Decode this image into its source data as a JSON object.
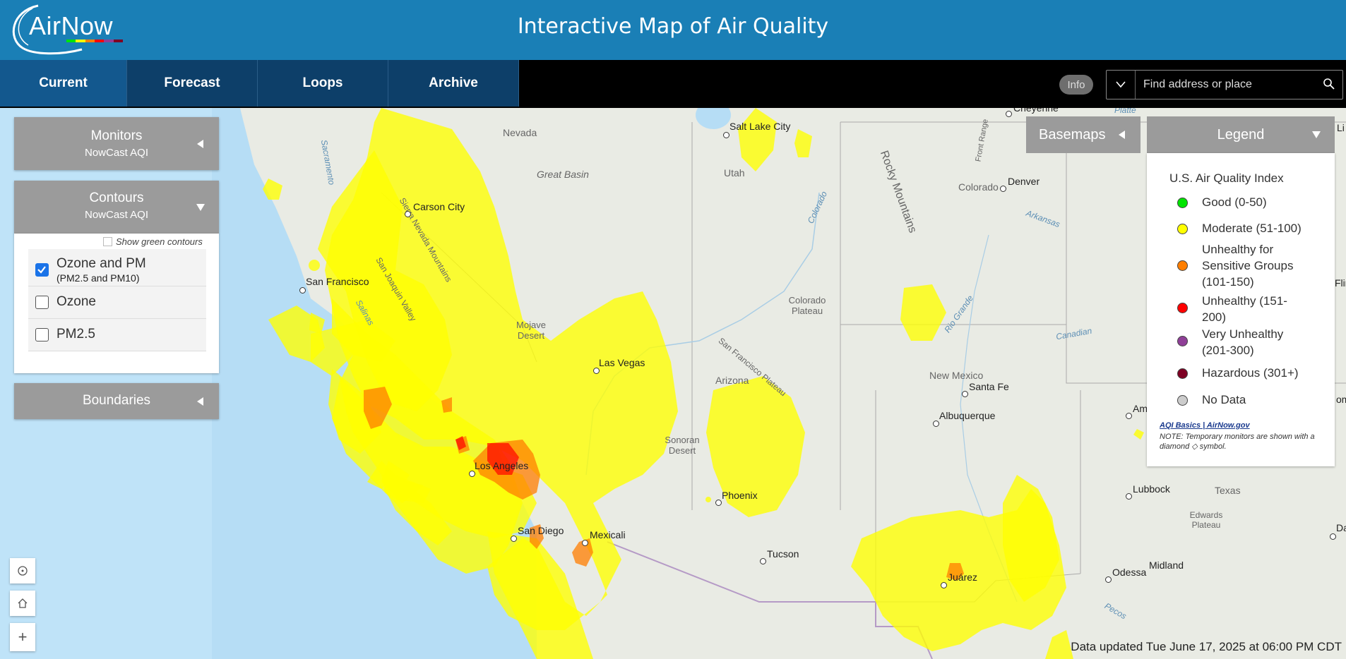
{
  "header": {
    "logo_text": "AirNow",
    "title": "Interactive Map of Air Quality"
  },
  "nav": {
    "tabs": [
      {
        "label": "Current",
        "active": true
      },
      {
        "label": "Forecast",
        "active": false
      },
      {
        "label": "Loops",
        "active": false
      },
      {
        "label": "Archive",
        "active": false
      }
    ],
    "info_label": "Info",
    "search_placeholder": "Find address or place"
  },
  "panels": {
    "monitors": {
      "title": "Monitors",
      "subtitle": "NowCast AQI"
    },
    "contours": {
      "title": "Contours",
      "subtitle": "NowCast AQI",
      "show_green_label": "Show green contours",
      "options": [
        {
          "label": "Ozone and PM",
          "sub": "(PM2.5 and PM10)",
          "checked": true
        },
        {
          "label": "Ozone",
          "sub": "",
          "checked": false
        },
        {
          "label": "PM2.5",
          "sub": "",
          "checked": false
        }
      ]
    },
    "boundaries": {
      "title": "Boundaries"
    }
  },
  "basemaps": {
    "title": "Basemaps"
  },
  "legend": {
    "title": "Legend",
    "index_title": "U.S. Air Quality Index",
    "items": [
      {
        "label": "Good (0-50)",
        "color": "#00e400"
      },
      {
        "label": "Moderate (51-100)",
        "color": "#ffff00"
      },
      {
        "label": "Unhealthy for Sensitive Groups (101-150)",
        "color": "#ff7e00"
      },
      {
        "label": "Unhealthy (151-200)",
        "color": "#ff0000"
      },
      {
        "label": "Very Unhealthy (201-300)",
        "color": "#8f3f97"
      },
      {
        "label": "Hazardous (301+)",
        "color": "#7e0023"
      },
      {
        "label": "No Data",
        "color": "#cccccc"
      }
    ],
    "link": "AQI Basics | AirNow.gov",
    "note": "NOTE: Temporary monitors are shown with a diamond ◇ symbol."
  },
  "map": {
    "cities": [
      "Salt Lake City",
      "Cheyenne",
      "Denver",
      "Carson City",
      "San Francisco",
      "Las Vegas",
      "Los Angeles",
      "San Diego",
      "Mexicali",
      "Phoenix",
      "Tucson",
      "Santa Fe",
      "Albuquerque",
      "Lubbock",
      "Midland",
      "Odessa",
      "Juárez"
    ],
    "regions": [
      "Nevada",
      "Utah",
      "Colorado",
      "Great Basin",
      "Arizona",
      "New Mexico",
      "Texas",
      "Colorado Plateau",
      "Mojave Desert",
      "Sonoran Desert",
      "Edwards Plateau",
      "Rocky Mountains",
      "Sierra Nevada Mountains",
      "San Joaquin Valley",
      "San Francisco Plateau",
      "Front Range"
    ],
    "water": [
      "Sacramento",
      "Colorado",
      "Arkansas",
      "Rio Grande",
      "Canadian",
      "Pecos",
      "Platte",
      "Salinas"
    ],
    "partial": [
      "Li",
      "Flin",
      "Am",
      "om",
      "Da"
    ]
  },
  "controls": {
    "locate": "locate-icon",
    "home": "home-icon",
    "zoom_in": "+"
  },
  "status": {
    "updated": "Data updated Tue June 17, 2025 at 06:00 PM CDT"
  },
  "colors": {
    "header": "#1a7fb6",
    "nav_tab": "#0d3f69",
    "panel": "#9b9b9b",
    "moderate": "#ffff00",
    "usg": "#ff7e00",
    "unhealthy": "#ff0000"
  }
}
